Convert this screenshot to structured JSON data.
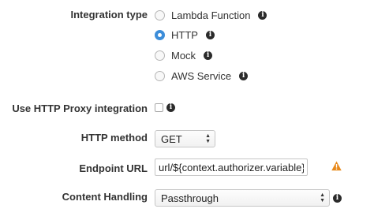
{
  "integration_type": {
    "label": "Integration type",
    "options": [
      {
        "label": "Lambda Function",
        "checked": false
      },
      {
        "label": "HTTP",
        "checked": true
      },
      {
        "label": "Mock",
        "checked": false
      },
      {
        "label": "AWS Service",
        "checked": false
      }
    ],
    "info_glyph": "i"
  },
  "http_proxy": {
    "label": "Use HTTP Proxy integration",
    "checked": false
  },
  "http_method": {
    "label": "HTTP method",
    "value": "GET"
  },
  "endpoint_url": {
    "label": "Endpoint URL",
    "value": "url/${context.authorizer.variable}",
    "warning_icon": "warning-icon"
  },
  "content_handling": {
    "label": "Content Handling",
    "value": "Passthrough"
  },
  "colors": {
    "radio_selected": "#3c8dd9",
    "warning": "#e8891b",
    "info_icon": "#2b2b2b"
  }
}
